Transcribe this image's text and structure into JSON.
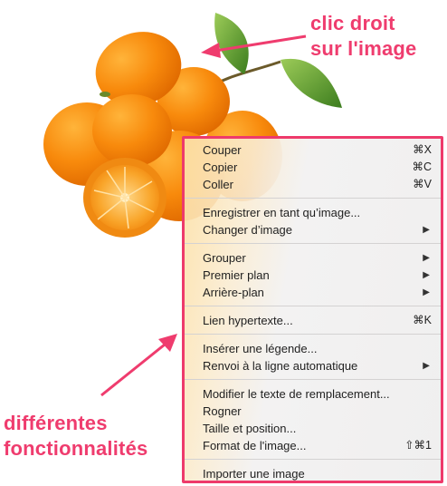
{
  "annotations": {
    "right_click": "clic droit\nsur l'image",
    "features": "différentes\nfonctionnalités"
  },
  "colors": {
    "accent": "#ef3c6e",
    "menu_border": "#ee3a6b",
    "menu_bg": "#f0efef"
  },
  "image": {
    "subject": "kumquats-photo"
  },
  "menu": {
    "groups": [
      [
        {
          "label": "Couper",
          "shortcut": "⌘X"
        },
        {
          "label": "Copier",
          "shortcut": "⌘C"
        },
        {
          "label": "Coller",
          "shortcut": "⌘V"
        }
      ],
      [
        {
          "label": "Enregistrer en tant qu’image..."
        },
        {
          "label": "Changer d’image",
          "submenu": true
        }
      ],
      [
        {
          "label": "Grouper",
          "submenu": true
        },
        {
          "label": "Premier plan",
          "submenu": true
        },
        {
          "label": "Arrière-plan",
          "submenu": true
        }
      ],
      [
        {
          "label": "Lien hypertexte...",
          "shortcut": "⌘K"
        }
      ],
      [
        {
          "label": "Insérer une légende..."
        },
        {
          "label": "Renvoi à la ligne automatique",
          "submenu": true
        }
      ],
      [
        {
          "label": "Modifier le texte de remplacement..."
        },
        {
          "label": "Rogner"
        },
        {
          "label": "Taille et position..."
        },
        {
          "label": "Format de l'image...",
          "shortcut": "⇧⌘1"
        }
      ],
      [
        {
          "label": "Importer une image"
        }
      ]
    ]
  }
}
